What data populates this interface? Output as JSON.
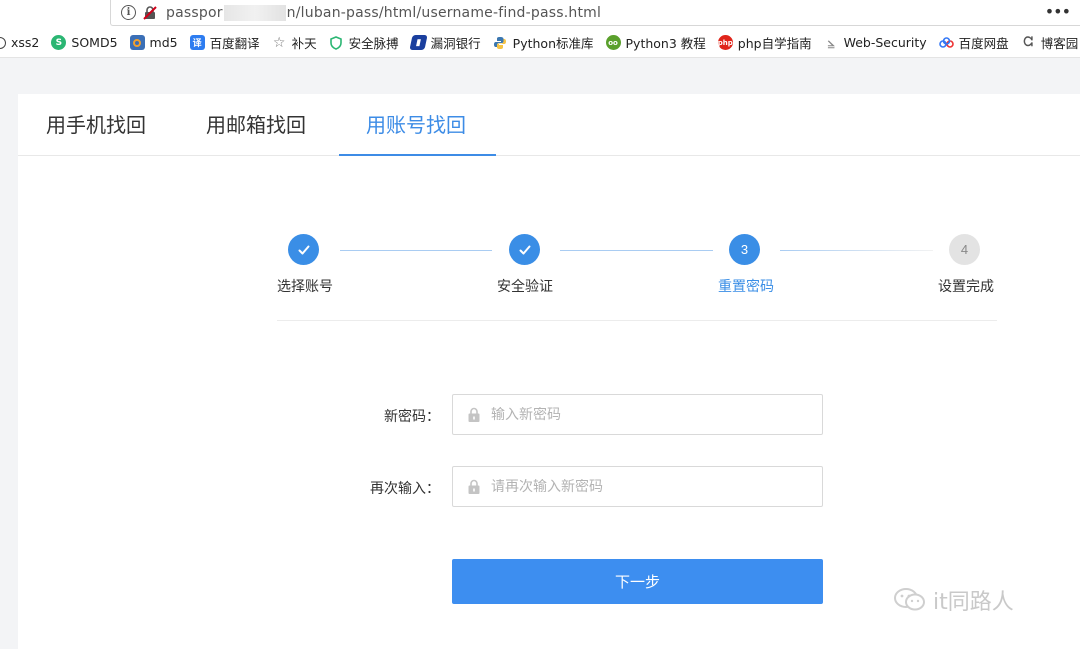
{
  "browser": {
    "url_prefix": "passpor",
    "url_suffix": "n/luban-pass/html/username-find-pass.html",
    "more_label": "•••"
  },
  "bookmarks": [
    {
      "label": "xss2",
      "color": "#444444",
      "icon": "partial-icon"
    },
    {
      "label": "SOMD5",
      "color": "#2bb673",
      "icon": "somd5-icon"
    },
    {
      "label": "md5",
      "color": "#e2762e",
      "icon": "md5-icon"
    },
    {
      "label": "百度翻译",
      "color": "#2d7cf0",
      "icon": "translate-icon"
    },
    {
      "label": "补天",
      "color": "#777777",
      "icon": "star-icon"
    },
    {
      "label": "安全脉搏",
      "color": "#2bb673",
      "icon": "shield-icon"
    },
    {
      "label": "漏洞银行",
      "color": "#1a3f9e",
      "icon": "bank-icon"
    },
    {
      "label": "Python标准库",
      "color": "#3b77b0",
      "icon": "python-icon"
    },
    {
      "label": "Python3 教程",
      "color": "#5aa02c",
      "icon": "runoob-icon"
    },
    {
      "label": "php自学指南",
      "color": "#e0251b",
      "icon": "php-icon"
    },
    {
      "label": "Web-Security",
      "color": "#888888",
      "icon": "web-security-icon"
    },
    {
      "label": "百度网盘",
      "color": "#3478f6",
      "icon": "cloud-disk-icon"
    },
    {
      "label": "博客园",
      "color": "#555555",
      "icon": "blog-icon"
    }
  ],
  "tabs": [
    {
      "label": "用手机找回",
      "active": false
    },
    {
      "label": "用邮箱找回",
      "active": false
    },
    {
      "label": "用账号找回",
      "active": true
    }
  ],
  "steps": [
    {
      "label": "选择账号",
      "state": "done",
      "number": ""
    },
    {
      "label": "安全验证",
      "state": "done",
      "number": ""
    },
    {
      "label": "重置密码",
      "state": "current",
      "number": "3"
    },
    {
      "label": "设置完成",
      "state": "todo",
      "number": "4"
    }
  ],
  "form": {
    "new_password_label": "新密码：",
    "new_password_placeholder": "输入新密码",
    "confirm_label": "再次输入：",
    "confirm_placeholder": "请再次输入新密码",
    "next_label": "下一步"
  },
  "watermark": {
    "text": "it同路人"
  },
  "colors": {
    "accent": "#3d8ce6",
    "button": "#3d8ef0"
  }
}
